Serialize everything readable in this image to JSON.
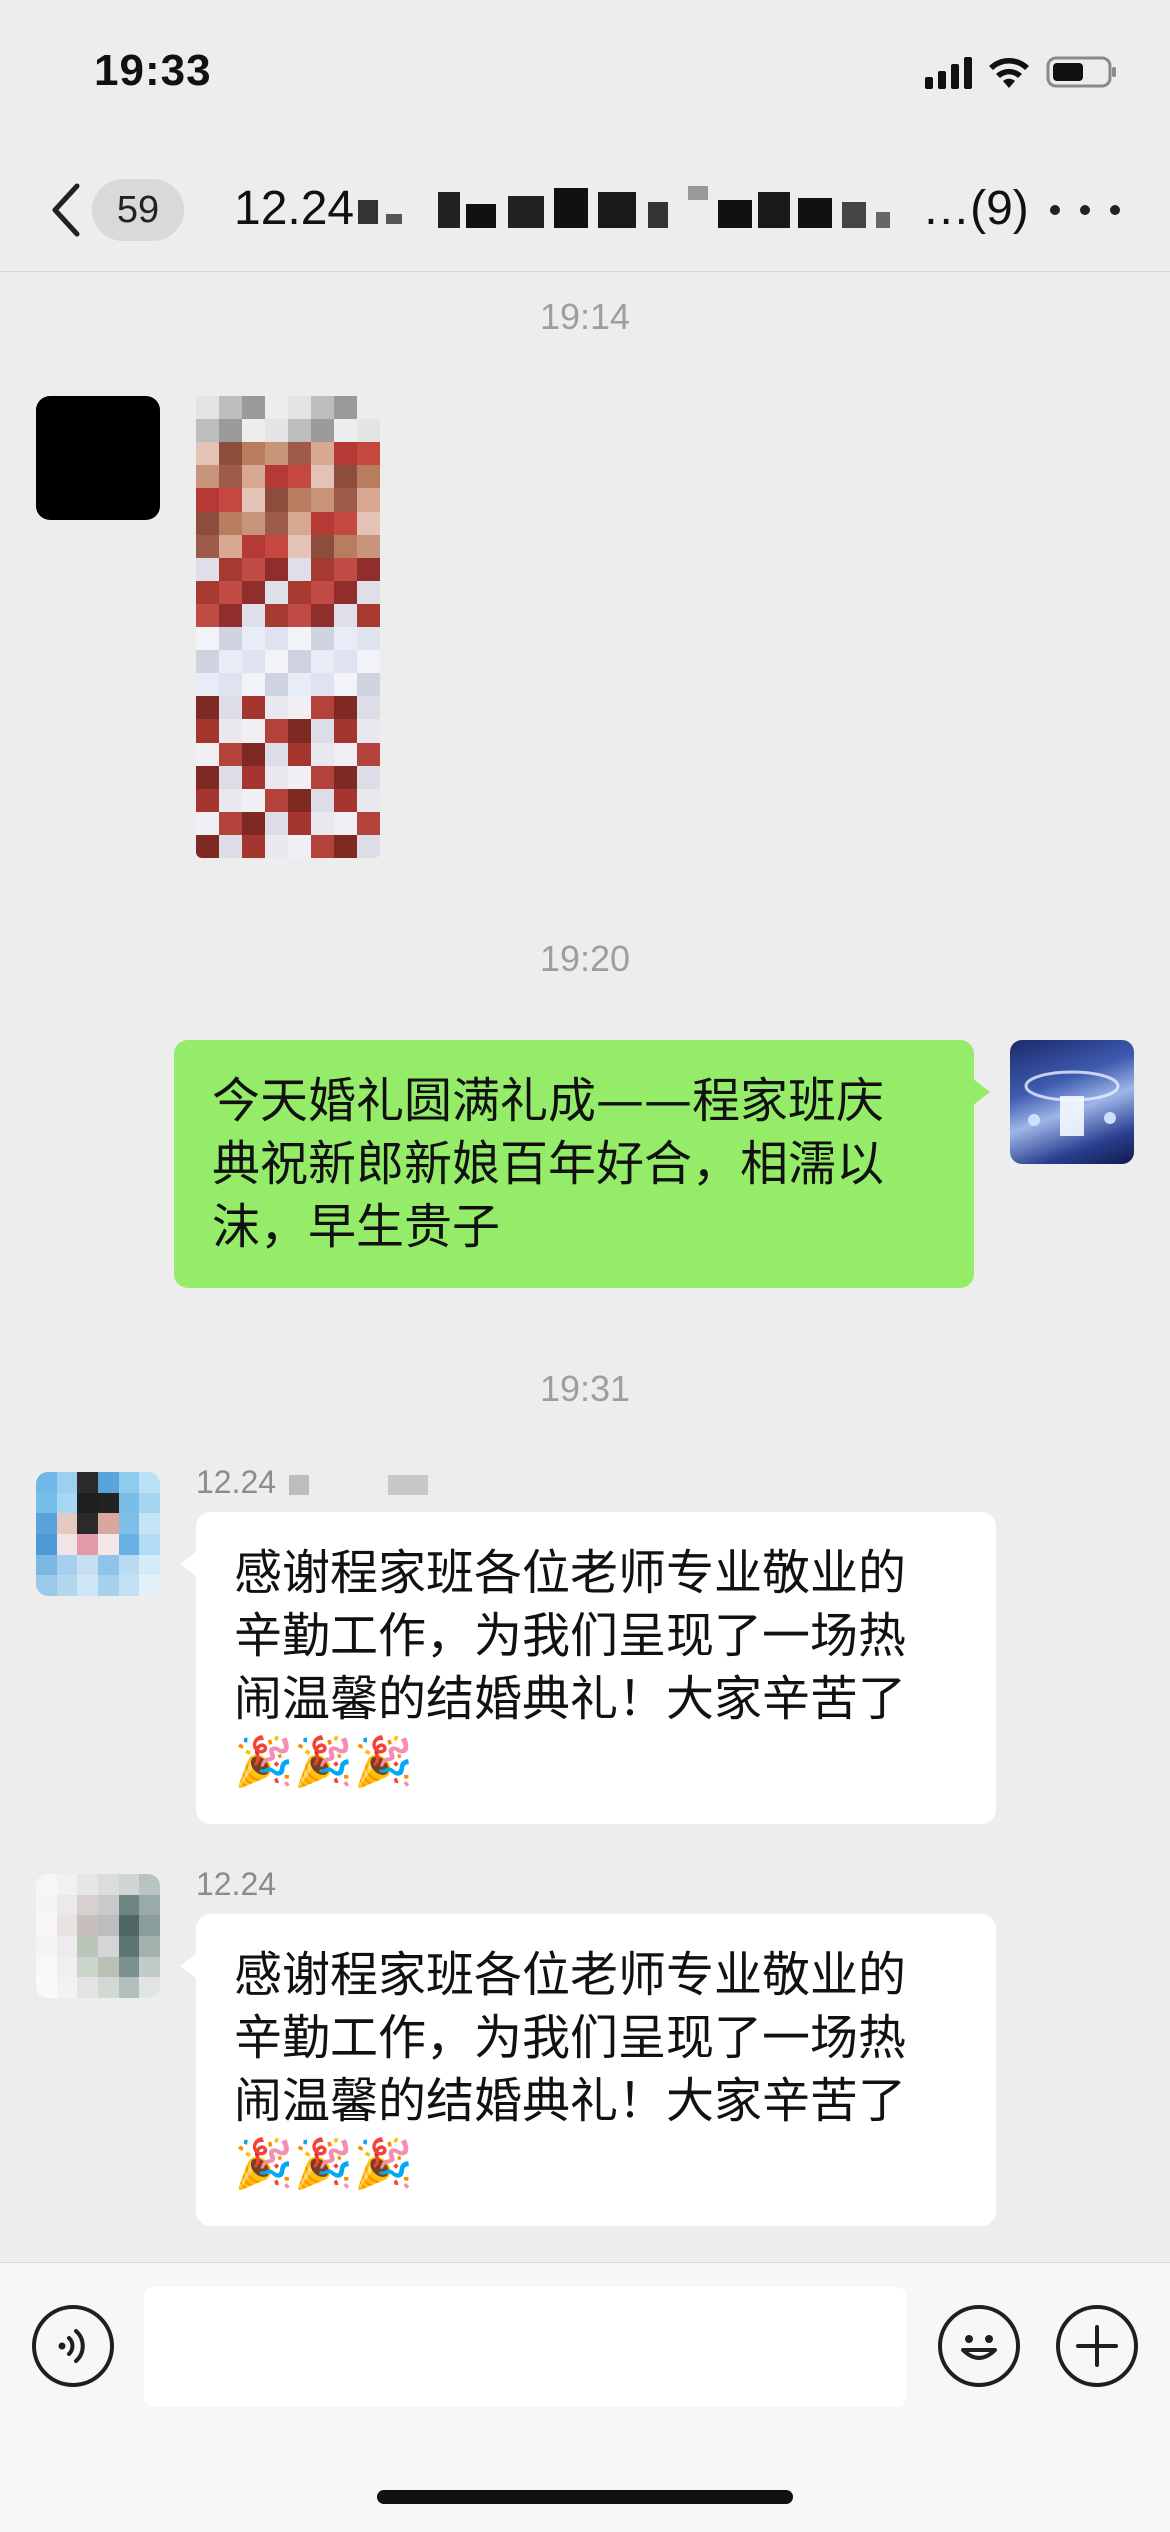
{
  "status_bar": {
    "time": "19:33",
    "icons": [
      "cellular-signal-icon",
      "wifi-icon",
      "battery-icon"
    ]
  },
  "nav": {
    "back_icon": "chevron-left-icon",
    "unread_count": "59",
    "title_prefix": "12.24",
    "title_suffix": "…(9)",
    "more_icon": "ellipsis-icon"
  },
  "messages": [
    {
      "type": "timestamp",
      "text": "19:14"
    },
    {
      "type": "image",
      "direction": "incoming",
      "content": "pixelated-photo"
    },
    {
      "type": "timestamp",
      "text": "19:20"
    },
    {
      "type": "text",
      "direction": "outgoing",
      "lines": [
        "今天婚礼圆满礼成——程家班庆",
        "典祝新郎新娘百年好合，相濡以",
        "沫，早生贵子"
      ]
    },
    {
      "type": "timestamp",
      "text": "19:31"
    },
    {
      "type": "text",
      "direction": "incoming",
      "sender": "12.24",
      "lines": [
        "感谢程家班各位老师专业敬业的",
        "辛勤工作，为我们呈现了一场热",
        "闹温馨的结婚典礼！大家辛苦了",
        "🎉🎉🎉"
      ]
    },
    {
      "type": "text",
      "direction": "incoming",
      "sender": "12.24",
      "lines": [
        "感谢程家班各位老师专业敬业的",
        "辛勤工作，为我们呈现了一场热",
        "闹温馨的结婚典礼！大家辛苦了",
        "🎉🎉🎉"
      ]
    }
  ],
  "input_bar": {
    "voice_icon": "voice-icon",
    "emoji_icon": "emoji-icon",
    "add_icon": "plus-icon",
    "placeholder": ""
  },
  "colors": {
    "background": "#ededed",
    "outgoing_bubble": "#95ec69",
    "incoming_bubble": "#ffffff",
    "timestamp": "#9e9e9e"
  }
}
